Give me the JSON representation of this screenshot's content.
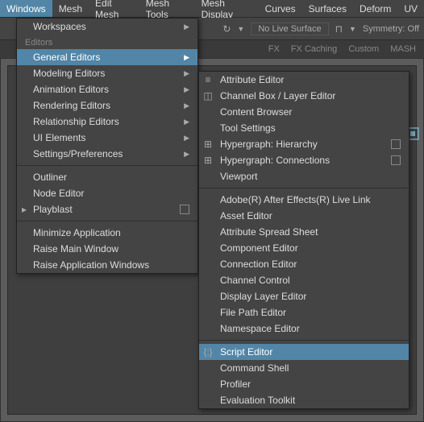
{
  "menubar": {
    "items": [
      "Windows",
      "Mesh",
      "Edit Mesh",
      "Mesh Tools",
      "Mesh Display",
      "Curves",
      "Surfaces",
      "Deform",
      "UV"
    ],
    "active_index": 0
  },
  "toolbar": {
    "live_surface": "No Live Surface",
    "symmetry": "Symmetry: Off"
  },
  "shelf_tabs": [
    "FX",
    "FX Caching",
    "Custom",
    "MASH"
  ],
  "menu1": {
    "section1_header": "Workspaces",
    "section2_header": "Editors",
    "items_a": [
      {
        "label": "General Editors",
        "arrow": true,
        "highlight": true
      },
      {
        "label": "Modeling Editors",
        "arrow": true
      },
      {
        "label": "Animation Editors",
        "arrow": true
      },
      {
        "label": "Rendering Editors",
        "arrow": true
      },
      {
        "label": "Relationship Editors",
        "arrow": true
      },
      {
        "label": "UI Elements",
        "arrow": true
      },
      {
        "label": "Settings/Preferences",
        "arrow": true
      }
    ],
    "items_b": [
      {
        "label": "Outliner"
      },
      {
        "label": "Node Editor"
      },
      {
        "label": "Playblast",
        "optbox": true,
        "icon": "▸"
      }
    ],
    "items_c": [
      {
        "label": "Minimize Application"
      },
      {
        "label": "Raise Main Window"
      },
      {
        "label": "Raise Application Windows"
      }
    ]
  },
  "menu2": {
    "items_a": [
      {
        "label": "Attribute Editor",
        "icon": "≡"
      },
      {
        "label": "Channel Box / Layer Editor",
        "icon": "◫"
      },
      {
        "label": "Content Browser"
      },
      {
        "label": "Tool Settings"
      },
      {
        "label": "Hypergraph: Hierarchy",
        "icon": "⊞",
        "optbox": true
      },
      {
        "label": "Hypergraph: Connections",
        "icon": "⊞",
        "optbox": true
      },
      {
        "label": "Viewport"
      }
    ],
    "items_b": [
      {
        "label": "Adobe(R) After Effects(R) Live Link"
      },
      {
        "label": "Asset Editor"
      },
      {
        "label": "Attribute Spread Sheet"
      },
      {
        "label": "Component Editor"
      },
      {
        "label": "Connection Editor"
      },
      {
        "label": "Channel Control"
      },
      {
        "label": "Display Layer Editor"
      },
      {
        "label": "File Path Editor"
      },
      {
        "label": "Namespace Editor"
      }
    ],
    "items_c": [
      {
        "label": "Script Editor",
        "icon": "{;}",
        "highlight": true
      },
      {
        "label": "Command Shell"
      },
      {
        "label": "Profiler"
      },
      {
        "label": "Evaluation Toolkit"
      }
    ]
  }
}
